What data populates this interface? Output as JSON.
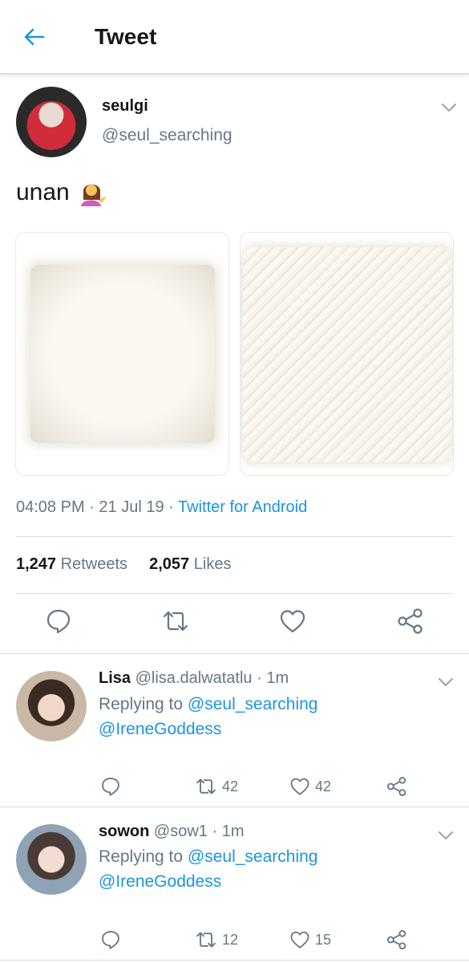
{
  "header": {
    "title": "Tweet"
  },
  "tweet": {
    "author_name": "seulgi",
    "author_handle": "@seul_searching",
    "text": "unan",
    "emoji_icon": "woman-tipping-hand-icon",
    "time": "04:08 PM",
    "separator": "·",
    "date": "21 Jul 19",
    "source": "Twitter for Android",
    "retweets_count": "1,247",
    "retweets_label": "Retweets",
    "likes_count": "2,057",
    "likes_label": "Likes",
    "media_count": 2
  },
  "replies": [
    {
      "name": "Lisa",
      "handle": "@lisa.dalwatatlu",
      "time": "1m",
      "replying_prefix": "Replying to",
      "reply_to_1": "@seul_searching",
      "reply_to_2": "@IreneGoddess",
      "retweets": "42",
      "likes": "42"
    },
    {
      "name": "sowon",
      "handle": "@sow1",
      "time": "1m",
      "replying_prefix": "Replying to",
      "reply_to_1": "@seul_searching",
      "reply_to_2": "@IreneGoddess",
      "retweets": "12",
      "likes": "15"
    }
  ],
  "colors": {
    "accent": "#1b95e0",
    "secondary_text": "#657786",
    "primary_text": "#14171a",
    "divider": "#d9dee2"
  }
}
